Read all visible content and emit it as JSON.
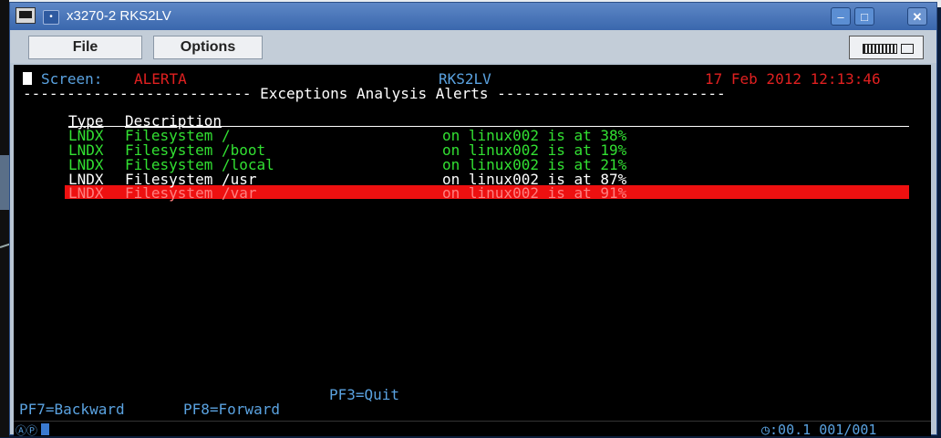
{
  "window": {
    "title": "x3270-2 RKS2LV",
    "menu": {
      "file": "File",
      "options": "Options"
    }
  },
  "screen": {
    "screen_label": "Screen:",
    "screen_name": "ALERTA",
    "system": "RKS2LV",
    "datetime": "17 Feb 2012 12:13:46",
    "banner": "-------------------------- Exceptions Analysis Alerts --------------------------",
    "col_type": "Type",
    "col_desc": "Description",
    "rows": [
      {
        "type": "LNDX",
        "desc": "Filesystem /",
        "detail": "on linux002 is at 38%",
        "color": "#32e032"
      },
      {
        "type": "LNDX",
        "desc": "Filesystem /boot",
        "detail": "on linux002 is at 19%",
        "color": "#32e032"
      },
      {
        "type": "LNDX",
        "desc": "Filesystem /local",
        "detail": "on linux002 is at 21%",
        "color": "#32e032"
      },
      {
        "type": "LNDX",
        "desc": "Filesystem /usr",
        "detail": "on linux002 is at 87%",
        "color": "#ffffff"
      },
      {
        "type": "LNDX",
        "desc": "Filesystem /var",
        "detail": "on linux002 is at 91%",
        "color": "#ee1010"
      }
    ],
    "pf3": "PF3=Quit",
    "pf7": "PF7=Backward",
    "pf8": "PF8=Forward"
  },
  "status": {
    "position": ":00.1 001/001"
  }
}
